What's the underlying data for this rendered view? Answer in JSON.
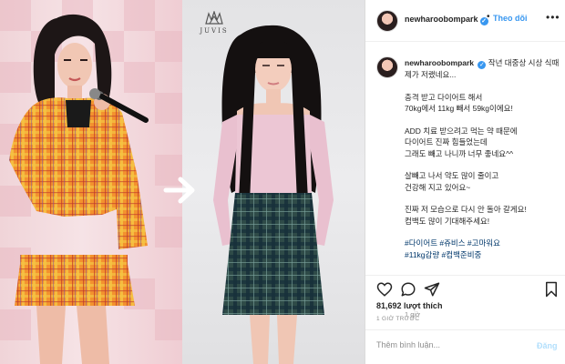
{
  "brand": {
    "name": "JUVIS"
  },
  "header": {
    "username": "newharoobompark",
    "verified": "✓",
    "separator": "•",
    "follow_label": "Theo dõi",
    "more_label": "•••"
  },
  "caption": {
    "username": "newharoobompark",
    "lines": [
      "작년 대중상 시상 식때 제가 저랬네요...",
      "충격 받고 다이어트 해서\n70kg에서 11kg 빼서 59kg이에요!",
      "ADD 치료 받으려고 먹는 약 때문에\n다이어트 진짜 힘들었는데\n그래도 빼고 나니까 너무 좋네요^^",
      "살빼고 나서 약도 많이 줄이고\n건강해 지고 있어요~",
      "진짜 저 모습으로 다시 안 돌아 갈게요!\n컴백도 많이 기대해주세요!"
    ],
    "hashtags": "#다이어트 #쥬비스 #고마워요\n#11kg감량 #컴백준비중",
    "time": "1 giờ"
  },
  "actions": {
    "like": "heart-icon",
    "comment": "comment-icon",
    "share": "share-icon",
    "save": "bookmark-icon"
  },
  "likes_text": "81,692 lượt thích",
  "posted_ago": "1 GIỜ TRƯỚC",
  "comment": {
    "placeholder": "Thêm bình luận...",
    "post_label": "Đăng"
  },
  "colors": {
    "accent": "#3897f0",
    "post_disabled": "#b2dffc",
    "hashtag": "#00376b"
  }
}
